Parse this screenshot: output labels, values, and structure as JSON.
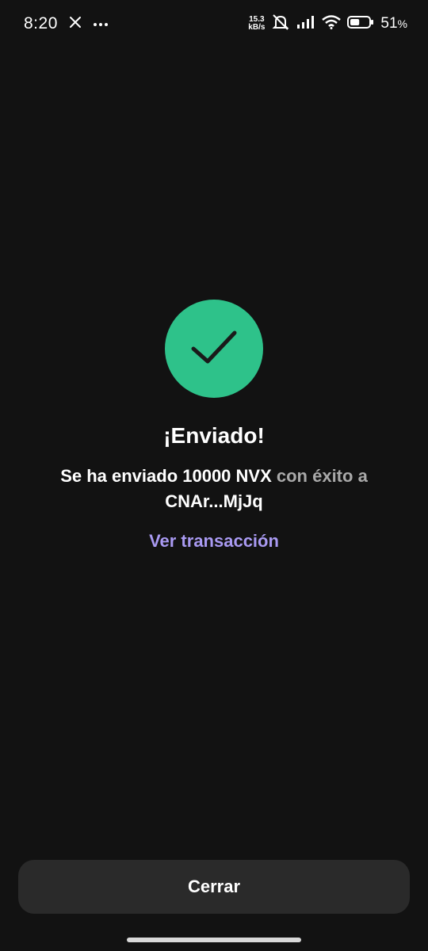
{
  "status_bar": {
    "time": "8:20",
    "net_speed_value": "15.3",
    "net_speed_unit": "kB/s",
    "battery_value": "51",
    "battery_unit": "%",
    "icons": [
      "x-logo-icon",
      "more-dots-icon",
      "silent-icon",
      "signal-icon",
      "wifi-icon",
      "battery-icon"
    ],
    "battery_level": 0.51
  },
  "main": {
    "success_icon": "checkmark-icon",
    "success_color": "#2ec28a",
    "title": "¡Enviado!",
    "message_part1": "Se ha enviado 10000 NVX",
    "message_part2": " con éxito a ",
    "message_address": "CNAr...MjJq",
    "view_transaction_label": "Ver transacción",
    "link_color": "#a99af2"
  },
  "footer": {
    "close_label": "Cerrar"
  }
}
